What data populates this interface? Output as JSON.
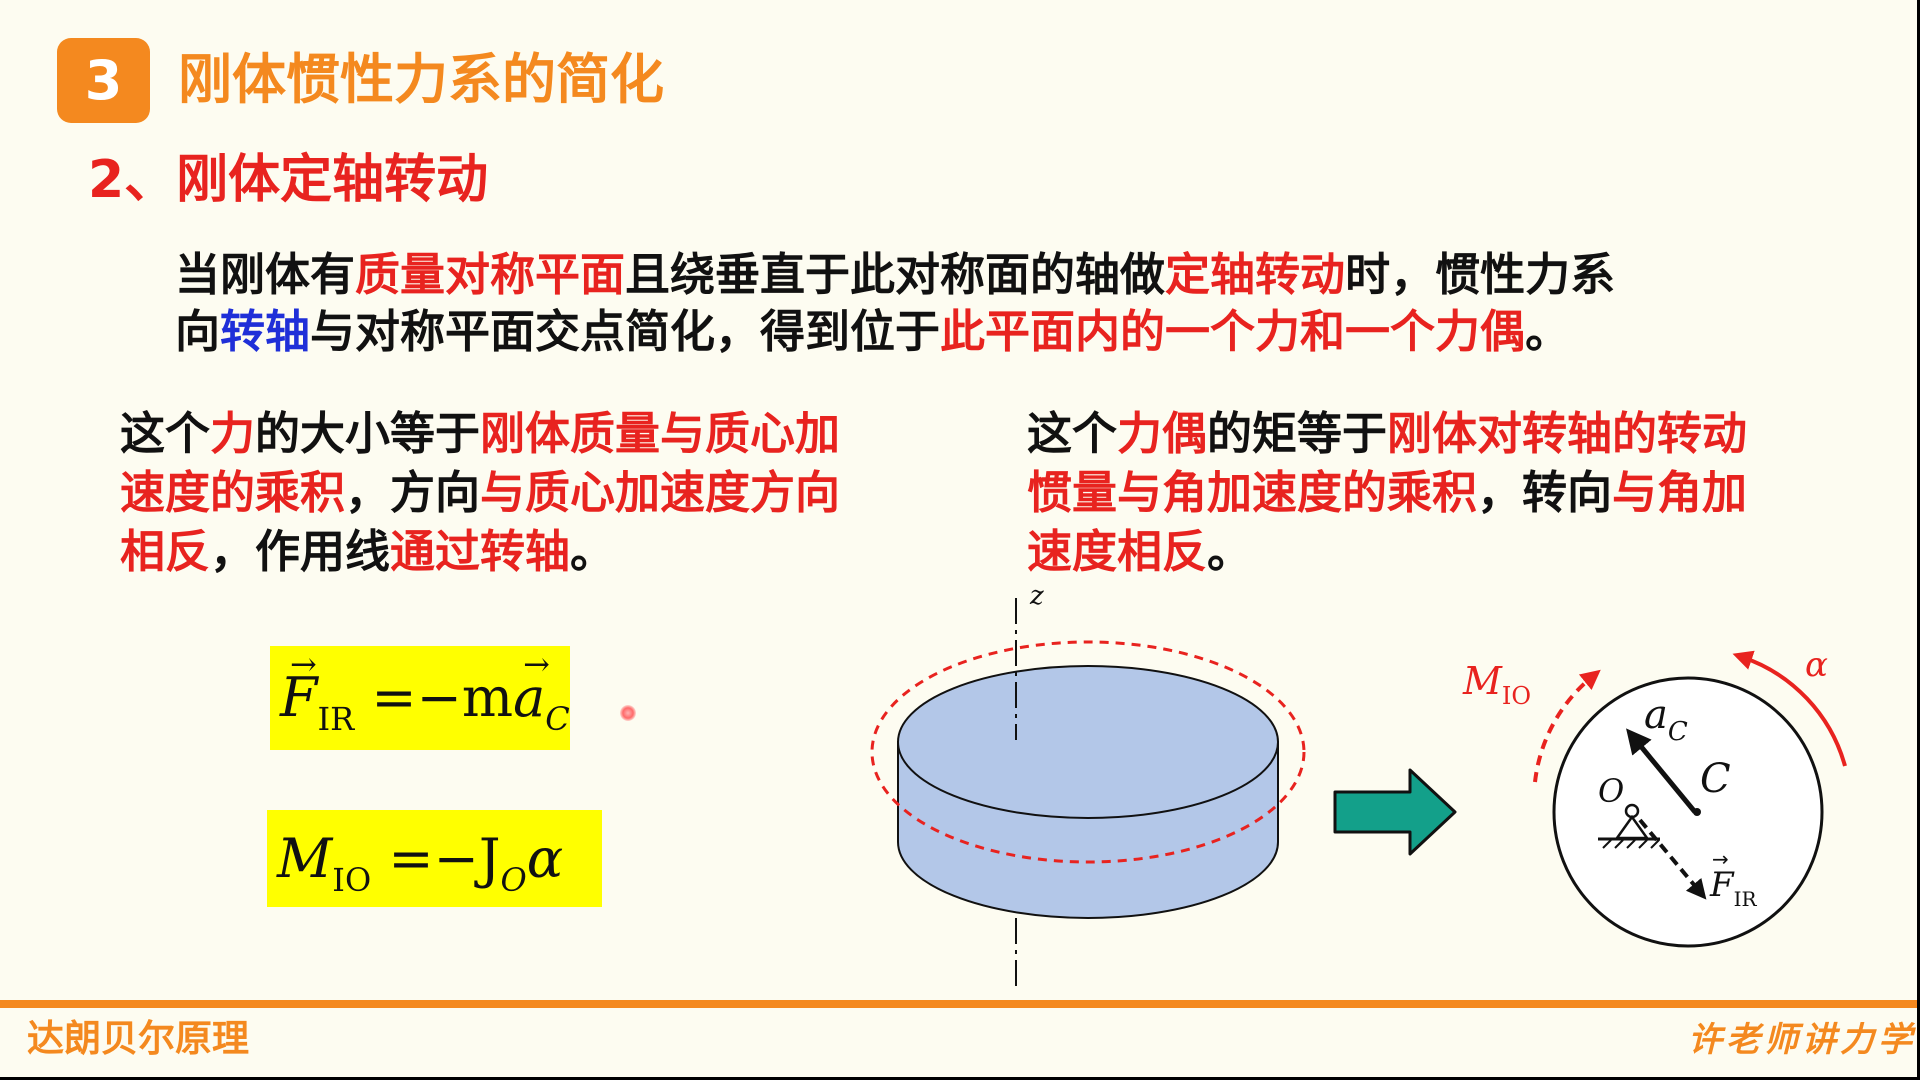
{
  "section": {
    "number": "3",
    "title": "刚体惯性力系的简化"
  },
  "subtitle": "2、刚体定轴转动",
  "intro": [
    {
      "text": "当刚体有",
      "style": "k"
    },
    {
      "text": "质量对称平面",
      "style": "r"
    },
    {
      "text": "且绕垂直于此对称面的轴做",
      "style": "k"
    },
    {
      "text": "定轴转动",
      "style": "r"
    },
    {
      "text": "时，惯性力系",
      "style": "k"
    },
    {
      "text": "\n",
      "style": "br"
    },
    {
      "text": "向",
      "style": "k"
    },
    {
      "text": "转轴",
      "style": "b"
    },
    {
      "text": "与对称平面交点简化，得到位于",
      "style": "k"
    },
    {
      "text": "此平面内的一个力和一个力偶",
      "style": "r"
    },
    {
      "text": "。",
      "style": "k"
    }
  ],
  "force_text": [
    {
      "text": "这个",
      "style": "k"
    },
    {
      "text": "力",
      "style": "r"
    },
    {
      "text": "的大小等于",
      "style": "k"
    },
    {
      "text": "刚体质量与质心加",
      "style": "r"
    },
    {
      "text": "\n",
      "style": "br"
    },
    {
      "text": "速度的乘积",
      "style": "r"
    },
    {
      "text": "，方向",
      "style": "k"
    },
    {
      "text": "与质心加速度方向",
      "style": "r"
    },
    {
      "text": "\n",
      "style": "br"
    },
    {
      "text": "相反",
      "style": "r"
    },
    {
      "text": "，作用线",
      "style": "k"
    },
    {
      "text": "通过转轴",
      "style": "r"
    },
    {
      "text": "。",
      "style": "k"
    }
  ],
  "couple_text": [
    {
      "text": "这个",
      "style": "k"
    },
    {
      "text": "力偶",
      "style": "r"
    },
    {
      "text": "的矩等于",
      "style": "k"
    },
    {
      "text": "刚体对转轴的转动",
      "style": "r"
    },
    {
      "text": "\n",
      "style": "br"
    },
    {
      "text": "惯量与角加速度的乘积",
      "style": "r"
    },
    {
      "text": "，转向",
      "style": "k"
    },
    {
      "text": "与角加",
      "style": "r"
    },
    {
      "text": "\n",
      "style": "br"
    },
    {
      "text": "速度相反",
      "style": "r"
    },
    {
      "text": "。",
      "style": "k"
    }
  ],
  "formula1": {
    "lhs": "F",
    "lhs_sub": "IR",
    "eq": "=−m",
    "rhs": "a",
    "rhs_sub": "C"
  },
  "formula2": {
    "lhs": "M",
    "lhs_sub": "IO",
    "eq": "=−J",
    "rhs_sub": "O",
    "rhs": "α"
  },
  "diagram": {
    "axis_label": "z",
    "moment_label": "M",
    "moment_sub": "IO",
    "alpha_label": "α",
    "accel_label": "a",
    "accel_sub": "C",
    "center_label": "C",
    "pivot_label": "O",
    "force_label": "F",
    "force_sub": "IR"
  },
  "footer": {
    "left": "达朗贝尔原理",
    "right": "许老师讲力学"
  },
  "colors": {
    "accent": "#f4891f",
    "red": "#e8231f",
    "blue": "#1f2fd8",
    "disk": "#b3c7e8",
    "arrow": "#13a08a",
    "highlight": "#ffff00"
  }
}
